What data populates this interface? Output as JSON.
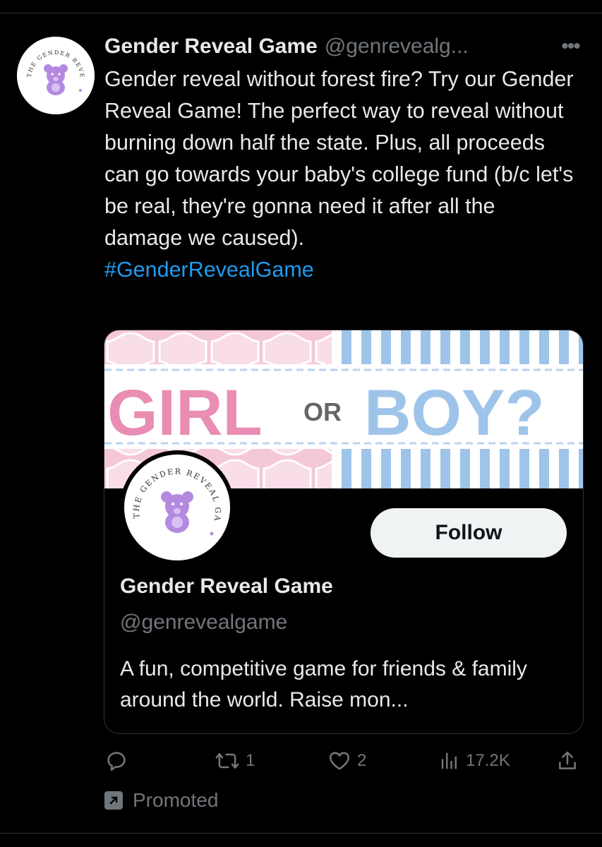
{
  "tweet": {
    "author_name": "Gender Reveal Game",
    "author_handle": "@genrevealg...",
    "more_label": "•••",
    "text": "Gender reveal without forest fire? Try our Gender Reveal Game! The perfect way to reveal without burning down half the state. Plus, all proceeds can go towards your baby's college fund (b/c let's be real, they're gonna need it after all the damage we caused).",
    "hashtag": "#GenderRevealGame"
  },
  "logo": {
    "text": "THE GENDER REVEAL GAME",
    "icon": "teddy-bear-icon"
  },
  "card": {
    "banner": {
      "girl": "GIRL",
      "or": "OR",
      "boy": "BOY?",
      "colors": {
        "pink": "#e98db3",
        "blue": "#9fc4ea",
        "light_pink": "#f5c8d9",
        "gray": "#666666"
      }
    },
    "follow_label": "Follow",
    "name": "Gender Reveal Game",
    "handle": "@genrevealgame",
    "bio": "A fun, competitive game for friends & family around the world. Raise mon..."
  },
  "actions": {
    "reply_icon": "reply-icon",
    "retweet_count": "1",
    "like_count": "2",
    "views_count": "17.2K",
    "share_icon": "share-icon"
  },
  "promoted_label": "Promoted",
  "colors": {
    "background": "#000000",
    "text": "#e7e9ea",
    "muted": "#71767b",
    "link": "#1d9bf0",
    "logo_purple": "#b48ae0"
  }
}
